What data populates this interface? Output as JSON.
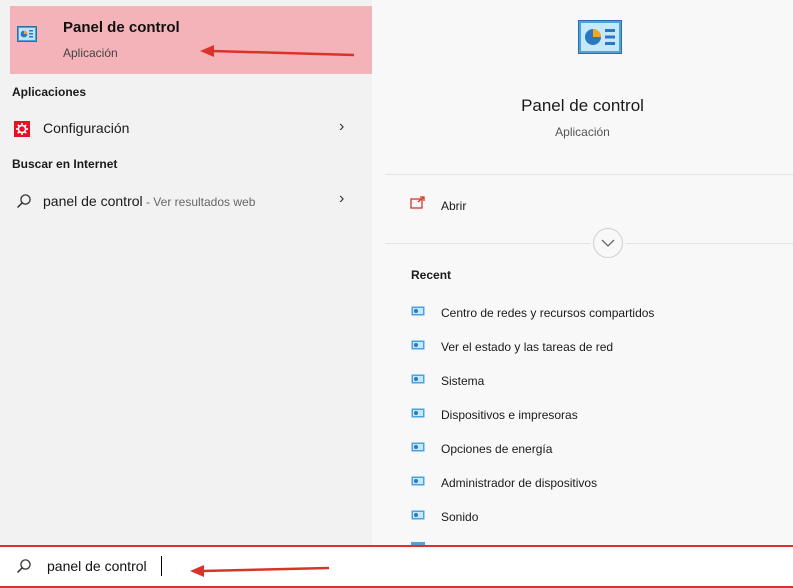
{
  "best_match": {
    "title": "Panel de control",
    "subtitle": "Aplicación"
  },
  "sections": {
    "apps_header": "Aplicaciones",
    "web_header": "Buscar en Internet"
  },
  "apps": [
    {
      "label": "Configuración",
      "icon": "gear-icon"
    }
  ],
  "web": {
    "query": "panel de control",
    "suffix": " - Ver resultados web"
  },
  "detail": {
    "title": "Panel de control",
    "subtitle": "Aplicación",
    "open_label": "Abrir",
    "recent_header": "Recent",
    "recent_items": [
      "Centro de redes y recursos compartidos",
      "Ver el estado y las tareas de red",
      "Sistema",
      "Dispositivos e impresoras",
      "Opciones de energía",
      "Administrador de dispositivos",
      "Sonido"
    ]
  },
  "search": {
    "value": "panel de control"
  },
  "colors": {
    "highlight": "#f4b3b8",
    "annotation_red": "#d9342b",
    "gear_red": "#e81123"
  }
}
